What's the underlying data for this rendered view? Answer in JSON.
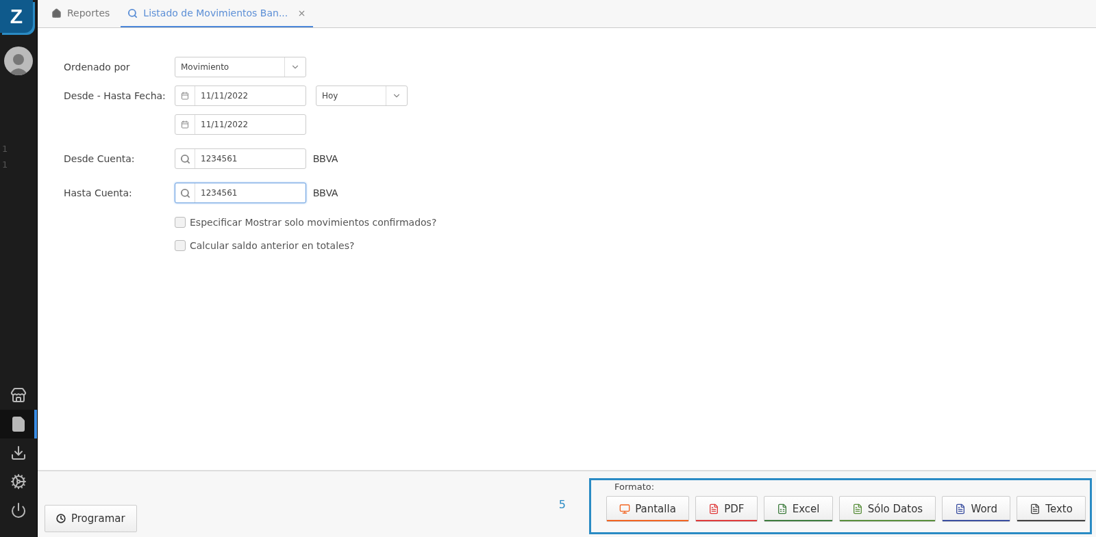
{
  "logo": {
    "letter": "Z"
  },
  "sidebar": {
    "counters": [
      "1",
      "1"
    ],
    "items": [
      {
        "kind": "store",
        "selected": false
      },
      {
        "kind": "file",
        "selected": true
      },
      {
        "kind": "download",
        "selected": false
      },
      {
        "kind": "settings",
        "selected": false
      },
      {
        "kind": "power",
        "selected": false
      }
    ]
  },
  "tabs": [
    {
      "kind": "home",
      "label": "Reportes",
      "selected": false,
      "closable": false
    },
    {
      "kind": "search",
      "label": "Listado de Movimientos Ban...",
      "selected": true,
      "closable": true
    }
  ],
  "form": {
    "rows": [
      {
        "label": "Ordenado por",
        "fields": [
          {
            "kind": "select",
            "value": "Movimiento"
          }
        ]
      },
      {
        "label": "Desde - Hasta Fecha:",
        "fields": [
          {
            "kind": "date",
            "value": "11/11/2022"
          },
          {
            "kind": "select",
            "value": "Hoy"
          }
        ]
      },
      {
        "label": "",
        "fields": [
          {
            "kind": "date",
            "value": "11/11/2022"
          }
        ]
      },
      {
        "label": "Desde Cuenta:",
        "fields": [
          {
            "kind": "lookup",
            "value": "1234561",
            "focused": false,
            "note": "BBVA"
          }
        ]
      },
      {
        "label": "Hasta Cuenta:",
        "fields": [
          {
            "kind": "lookup",
            "value": "1234561",
            "focused": true,
            "note": "BBVA"
          }
        ]
      }
    ],
    "checkboxes": [
      {
        "label": "Especificar Mostrar solo movimientos confirmados?",
        "checked": false
      },
      {
        "label": "Calcular saldo anterior en totales?",
        "checked": false
      }
    ]
  },
  "footer": {
    "schedule_button": "Programar",
    "step_number": "5",
    "format_label": "Formato:",
    "formats": [
      {
        "kind": "screen",
        "label": "Pantalla",
        "color": "#f26522"
      },
      {
        "kind": "pdf",
        "label": "PDF",
        "color": "#e03c3c"
      },
      {
        "kind": "excel",
        "label": "Excel",
        "color": "#3f7d3f"
      },
      {
        "kind": "data",
        "label": "Sólo Datos",
        "color": "#5a8f3c"
      },
      {
        "kind": "word",
        "label": "Word",
        "color": "#3b4fa0"
      },
      {
        "kind": "text",
        "label": "Texto",
        "color": "#444444"
      }
    ]
  }
}
